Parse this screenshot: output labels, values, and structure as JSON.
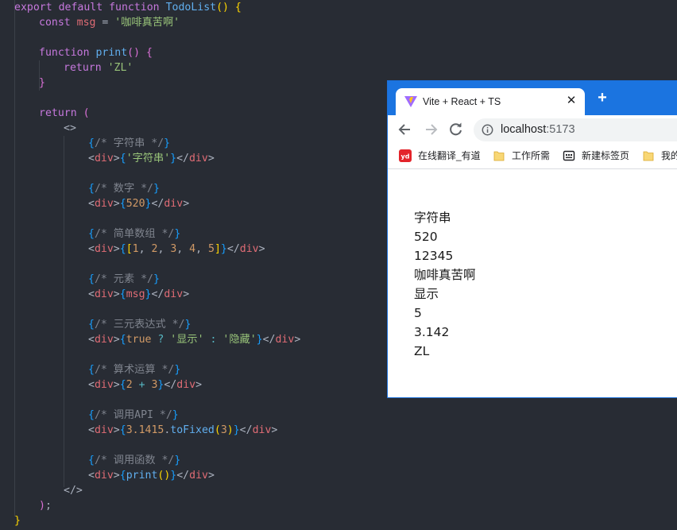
{
  "code_lines": [
    [
      [
        "kw",
        "export "
      ],
      [
        "kw",
        "default "
      ],
      [
        "kw",
        "function "
      ],
      [
        "fn",
        "TodoList"
      ],
      [
        "br1",
        "() {"
      ]
    ],
    [
      [
        "kw",
        "const "
      ],
      [
        "var",
        "msg "
      ],
      [
        "punc",
        "= "
      ],
      [
        "str",
        "'咖啡真苦啊'"
      ]
    ],
    [],
    [
      [
        "kw",
        "function "
      ],
      [
        "fn",
        "print"
      ],
      [
        "br2",
        "() {"
      ]
    ],
    [
      [
        "kw",
        "return "
      ],
      [
        "str",
        "'ZL'"
      ]
    ],
    [
      [
        "br2",
        "}"
      ]
    ],
    [],
    [
      [
        "kw",
        "return "
      ],
      [
        "br2",
        "("
      ]
    ],
    [
      [
        "punc",
        "<>"
      ]
    ],
    [
      [
        "br3",
        "{"
      ],
      [
        "cm",
        "/* 字符串 */"
      ],
      [
        "br3",
        "}"
      ]
    ],
    [
      [
        "punc",
        "<"
      ],
      [
        "tag",
        "div"
      ],
      [
        "punc",
        ">"
      ],
      [
        "br3",
        "{"
      ],
      [
        "str",
        "'字符串'"
      ],
      [
        "br3",
        "}"
      ],
      [
        "punc",
        "</"
      ],
      [
        "tag",
        "div"
      ],
      [
        "punc",
        ">"
      ]
    ],
    [],
    [
      [
        "br3",
        "{"
      ],
      [
        "cm",
        "/* 数字 */"
      ],
      [
        "br3",
        "}"
      ]
    ],
    [
      [
        "punc",
        "<"
      ],
      [
        "tag",
        "div"
      ],
      [
        "punc",
        ">"
      ],
      [
        "br3",
        "{"
      ],
      [
        "num",
        "520"
      ],
      [
        "br3",
        "}"
      ],
      [
        "punc",
        "</"
      ],
      [
        "tag",
        "div"
      ],
      [
        "punc",
        ">"
      ]
    ],
    [],
    [
      [
        "br3",
        "{"
      ],
      [
        "cm",
        "/* 简单数组 */"
      ],
      [
        "br3",
        "}"
      ]
    ],
    [
      [
        "punc",
        "<"
      ],
      [
        "tag",
        "div"
      ],
      [
        "punc",
        ">"
      ],
      [
        "br3",
        "{"
      ],
      [
        "br1",
        "["
      ],
      [
        "num",
        "1"
      ],
      [
        "punc",
        ", "
      ],
      [
        "num",
        "2"
      ],
      [
        "punc",
        ", "
      ],
      [
        "num",
        "3"
      ],
      [
        "punc",
        ", "
      ],
      [
        "num",
        "4"
      ],
      [
        "punc",
        ", "
      ],
      [
        "num",
        "5"
      ],
      [
        "br1",
        "]"
      ],
      [
        "br3",
        "}"
      ],
      [
        "punc",
        "</"
      ],
      [
        "tag",
        "div"
      ],
      [
        "punc",
        ">"
      ]
    ],
    [],
    [
      [
        "br3",
        "{"
      ],
      [
        "cm",
        "/* 元素 */"
      ],
      [
        "br3",
        "}"
      ]
    ],
    [
      [
        "punc",
        "<"
      ],
      [
        "tag",
        "div"
      ],
      [
        "punc",
        ">"
      ],
      [
        "br3",
        "{"
      ],
      [
        "var",
        "msg"
      ],
      [
        "br3",
        "}"
      ],
      [
        "punc",
        "</"
      ],
      [
        "tag",
        "div"
      ],
      [
        "punc",
        ">"
      ]
    ],
    [],
    [
      [
        "br3",
        "{"
      ],
      [
        "cm",
        "/* 三元表达式 */"
      ],
      [
        "br3",
        "}"
      ]
    ],
    [
      [
        "punc",
        "<"
      ],
      [
        "tag",
        "div"
      ],
      [
        "punc",
        ">"
      ],
      [
        "br3",
        "{"
      ],
      [
        "num",
        "true "
      ],
      [
        "tern",
        "? "
      ],
      [
        "str",
        "'显示' "
      ],
      [
        "tern",
        ": "
      ],
      [
        "str",
        "'隐藏'"
      ],
      [
        "br3",
        "}"
      ],
      [
        "punc",
        "</"
      ],
      [
        "tag",
        "div"
      ],
      [
        "punc",
        ">"
      ]
    ],
    [],
    [
      [
        "br3",
        "{"
      ],
      [
        "cm",
        "/* 算术运算 */"
      ],
      [
        "br3",
        "}"
      ]
    ],
    [
      [
        "punc",
        "<"
      ],
      [
        "tag",
        "div"
      ],
      [
        "punc",
        ">"
      ],
      [
        "br3",
        "{"
      ],
      [
        "num",
        "2 "
      ],
      [
        "tern",
        "+ "
      ],
      [
        "num",
        "3"
      ],
      [
        "br3",
        "}"
      ],
      [
        "punc",
        "</"
      ],
      [
        "tag",
        "div"
      ],
      [
        "punc",
        ">"
      ]
    ],
    [],
    [
      [
        "br3",
        "{"
      ],
      [
        "cm",
        "/* 调用API */"
      ],
      [
        "br3",
        "}"
      ]
    ],
    [
      [
        "punc",
        "<"
      ],
      [
        "tag",
        "div"
      ],
      [
        "punc",
        ">"
      ],
      [
        "br3",
        "{"
      ],
      [
        "num",
        "3.1415"
      ],
      [
        "punc",
        "."
      ],
      [
        "fn",
        "toFixed"
      ],
      [
        "br1",
        "("
      ],
      [
        "num",
        "3"
      ],
      [
        "br1",
        ")"
      ],
      [
        "br3",
        "}"
      ],
      [
        "punc",
        "</"
      ],
      [
        "tag",
        "div"
      ],
      [
        "punc",
        ">"
      ]
    ],
    [],
    [
      [
        "br3",
        "{"
      ],
      [
        "cm",
        "/* 调用函数 */"
      ],
      [
        "br3",
        "}"
      ]
    ],
    [
      [
        "punc",
        "<"
      ],
      [
        "tag",
        "div"
      ],
      [
        "punc",
        ">"
      ],
      [
        "br3",
        "{"
      ],
      [
        "fn",
        "print"
      ],
      [
        "br1",
        "()"
      ],
      [
        "br3",
        "}"
      ],
      [
        "punc",
        "</"
      ],
      [
        "tag",
        "div"
      ],
      [
        "punc",
        ">"
      ]
    ],
    [
      [
        "punc",
        "</>"
      ]
    ],
    [
      [
        "br2",
        ")"
      ],
      [
        "punc",
        ";"
      ]
    ],
    [
      [
        "br1",
        "}"
      ]
    ]
  ],
  "browser": {
    "tab_title": "Vite + React + TS",
    "tab_close": "✕",
    "new_tab": "+",
    "url_host": "localhost",
    "url_port": ":5173",
    "bookmarks": [
      "在线翻译_有道",
      "工作所需",
      "新建标签页",
      "我的"
    ],
    "output_lines": [
      "字符串",
      "520",
      "12345",
      "咖啡真苦啊",
      "显示",
      "5",
      "3.142",
      "ZL"
    ]
  },
  "colors": {
    "editor_bg": "#282c34",
    "tabstrip": "#1b74e0",
    "vite_purple": "#9f6bff",
    "vite_yellow": "#ffc517",
    "youdao_red": "#e3242b",
    "folder_yellow": "#f8d775"
  }
}
